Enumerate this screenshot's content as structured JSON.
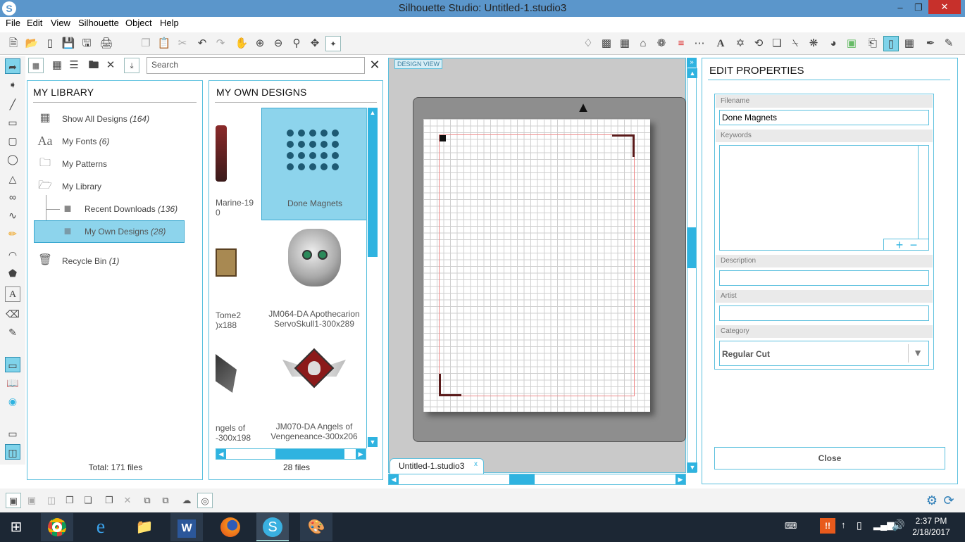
{
  "window": {
    "title": "Silhouette Studio: Untitled-1.studio3",
    "minimize": "–",
    "maximize": "❐",
    "close": "✕"
  },
  "menu": [
    "File",
    "Edit",
    "View",
    "Silhouette",
    "Object",
    "Help"
  ],
  "library": {
    "search_placeholder": "Search",
    "close": "✕",
    "header": "MY LIBRARY",
    "items": [
      {
        "label": "Show All Designs",
        "count": "(164)"
      },
      {
        "label": "My Fonts",
        "count": "(6)"
      },
      {
        "label": "My Patterns",
        "count": ""
      },
      {
        "label": "My Library",
        "count": ""
      },
      {
        "label": "Recent Downloads",
        "count": "(136)"
      },
      {
        "label": "My Own Designs",
        "count": "(28)"
      },
      {
        "label": "Recycle Bin",
        "count": "(1)"
      }
    ],
    "total": "Total: 171 files"
  },
  "designs": {
    "header": "MY OWN DESIGNS",
    "thumbs": [
      {
        "label": "Marine-19\n0"
      },
      {
        "label": "Done Magnets"
      },
      {
        "label": "Tome2\n)x188"
      },
      {
        "label": "JM064-DA Apothecarion\nServoSkull1-300x289"
      },
      {
        "label": "ngels of\n-300x198"
      },
      {
        "label": "JM070-DA Angels of\nVengeneance-300x206"
      }
    ],
    "count": "28 files"
  },
  "design_view": {
    "label": "DESIGN VIEW",
    "tab": "Untitled-1.studio3",
    "tab_close": "x"
  },
  "properties": {
    "header": "EDIT PROPERTIES",
    "filename_label": "Filename",
    "filename_value": "Done Magnets",
    "keywords_label": "Keywords",
    "description_label": "Description",
    "artist_label": "Artist",
    "category_label": "Category",
    "category_value": "Regular Cut",
    "close_button": "Close",
    "add": "+",
    "remove": "−"
  },
  "clock": {
    "time": "2:37 PM",
    "date": "2/18/2017"
  },
  "colors": {
    "accent": "#5bc0de",
    "selected": "#8dd4ec",
    "titlebar": "#5b96cb",
    "taskbar": "#1c2734",
    "close": "#c7302b"
  }
}
